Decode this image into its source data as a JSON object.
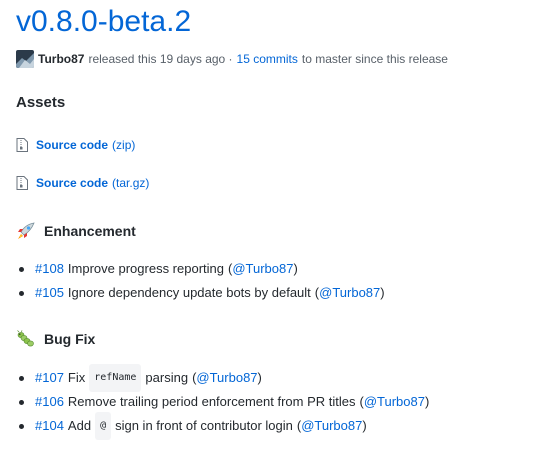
{
  "release": {
    "title": "v0.8.0-beta.2",
    "author": "Turbo87",
    "released_text": "released this 19 days ago ·",
    "commits_link": "15 commits",
    "commits_suffix": "to master since this release"
  },
  "assets": {
    "heading": "Assets",
    "items": [
      {
        "name": "Source code",
        "ext": "(zip)"
      },
      {
        "name": "Source code",
        "ext": "(tar.gz)"
      }
    ]
  },
  "sections": [
    {
      "heading": "Enhancement",
      "icon": "rocket-icon",
      "items": [
        {
          "pr": "#108",
          "text": "Improve progress reporting",
          "author": "@Turbo87"
        },
        {
          "pr": "#105",
          "text": "Ignore dependency update bots by default",
          "author": "@Turbo87"
        }
      ]
    },
    {
      "heading": "Bug Fix",
      "icon": "bug-icon",
      "items": [
        {
          "pr": "#107",
          "pre": "Fix",
          "code": "refName",
          "post": "parsing",
          "author": "@Turbo87"
        },
        {
          "pr": "#106",
          "text": "Remove trailing period enforcement from PR titles",
          "author": "@Turbo87"
        },
        {
          "pr": "#104",
          "pre": "Add",
          "code": "@",
          "post": "sign in front of contributor login",
          "author": "@Turbo87"
        }
      ]
    }
  ],
  "colors": {
    "link": "#0366d6",
    "text": "#24292e",
    "muted": "#586069"
  }
}
